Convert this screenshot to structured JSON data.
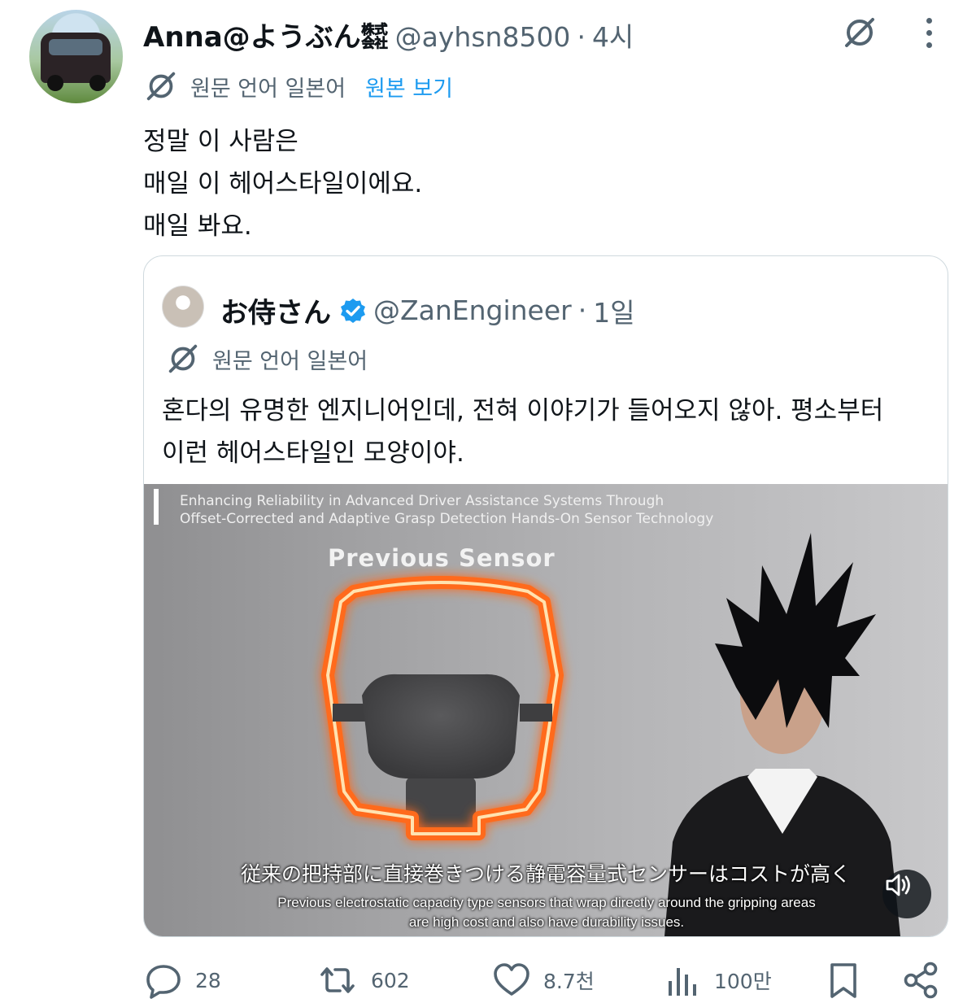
{
  "tweet": {
    "display_name": "Anna@ようぶん㍿",
    "handle": "@ayhsn8500",
    "separator": "·",
    "time": "4시",
    "lang_label": "원문 언어 일본어",
    "view_original": "원본 보기",
    "text_lines": [
      "정말 이 사람은",
      "매일 이 헤어스타일이에요.",
      "매일 봐요."
    ]
  },
  "quote": {
    "display_name": "お侍さん",
    "handle": "@ZanEngineer",
    "separator": "·",
    "time": "1일",
    "lang_label": "원문 언어 일본어",
    "text_lines": [
      "혼다의 유명한 엔지니어인데, 전혀 이야기가 들어오지 않아. 평소부터",
      "이런 헤어스타일인 모양이야."
    ],
    "media": {
      "title_lines": [
        "Enhancing Reliability in Advanced Driver Assistance Systems Through",
        "Offset-Corrected and Adaptive Grasp Detection Hands-On Sensor Technology"
      ],
      "sensor_label": "Previous Sensor",
      "subtitle_jp": "従来の把持部に直接巻きつける静電容量式センサーはコストが高く",
      "subtitle_en_lines": [
        "Previous electrostatic capacity type sensors that wrap directly around the gripping areas",
        "are high cost and also have durability issues."
      ]
    }
  },
  "actions": {
    "replies": "28",
    "reposts": "602",
    "likes": "8.7천",
    "views": "100만"
  },
  "icons": {
    "grok": "grok-icon",
    "more": "more-icon",
    "translate": "grok-icon",
    "verified": "verified-badge-icon",
    "reply": "reply-icon",
    "repost": "repost-icon",
    "like": "heart-icon",
    "views": "views-icon",
    "bookmark": "bookmark-icon",
    "share": "share-icon",
    "sound": "volume-icon"
  },
  "colors": {
    "text_primary": "#0f1419",
    "text_secondary": "#536471",
    "link": "#1d9bf0",
    "verified": "#1d9bf0",
    "border": "#cfd9de"
  }
}
